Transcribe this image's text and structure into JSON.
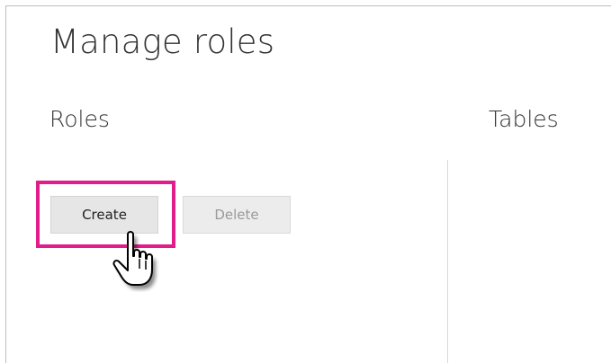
{
  "dialog": {
    "title": "Manage roles",
    "roles_heading": "Roles",
    "tables_heading": "Tables"
  },
  "actions": {
    "create_label": "Create",
    "delete_label": "Delete"
  },
  "colors": {
    "highlight": "#e31c8c"
  },
  "icons": {
    "cursor": "hand-pointer-icon"
  }
}
